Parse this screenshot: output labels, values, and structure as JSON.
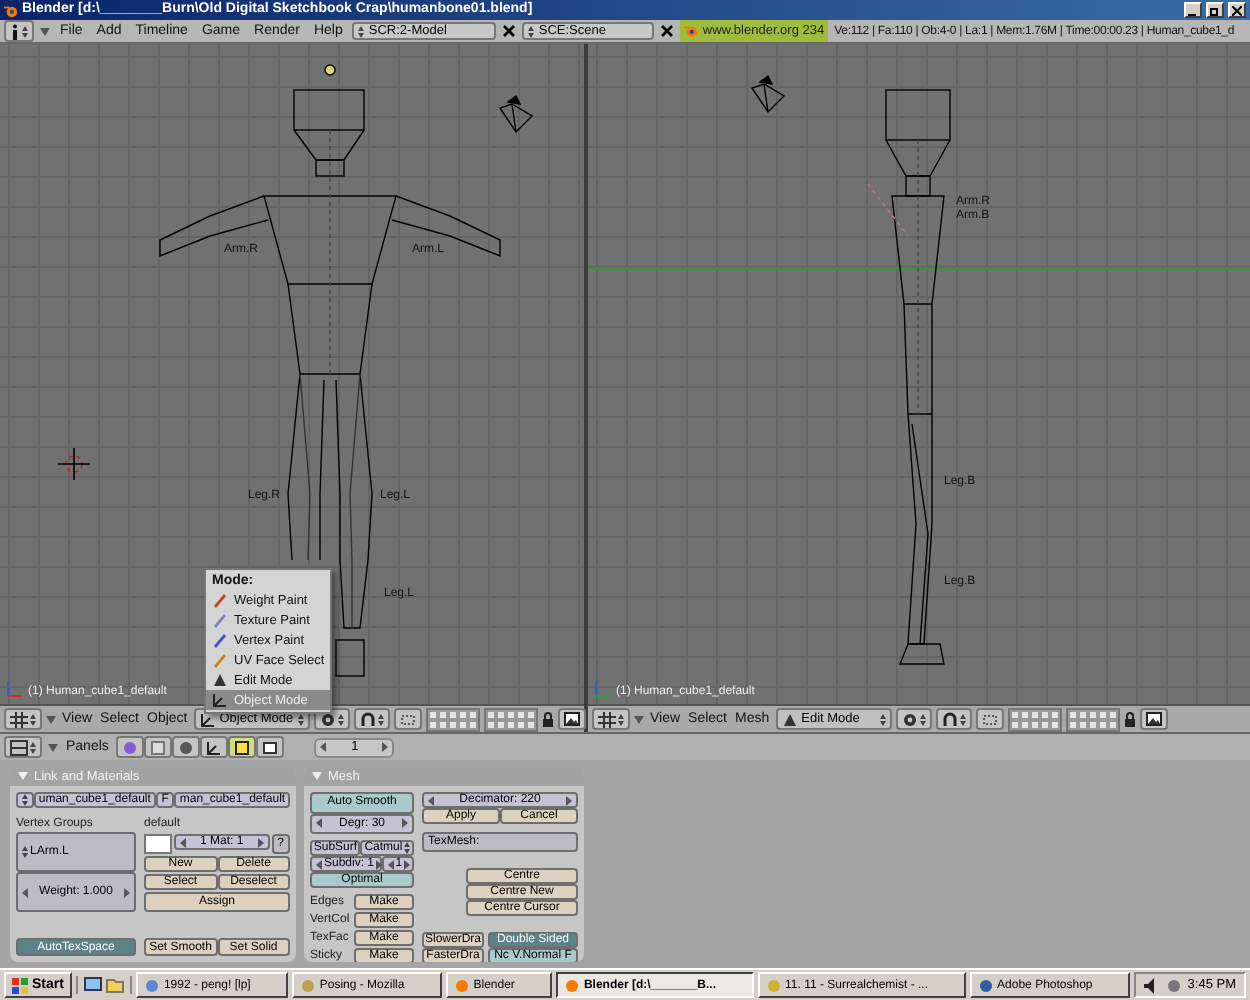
{
  "window": {
    "title": "Blender [d:\\________Burn\\Old Digital Sketchbook Crap\\humanbone01.blend]"
  },
  "menubar": {
    "menus": [
      "File",
      "Add",
      "Timeline",
      "Game",
      "Render",
      "Help"
    ],
    "screen": "SCR:2-Model",
    "scene": "SCE:Scene",
    "site": "www.blender.org 234",
    "stats": "Ve:112 | Fa:110 | Ob:4-0 | La:1 | Mem:1.76M | Time:00:00.23 | Human_cube1_d"
  },
  "viewports": [
    {
      "object_label": "(1) Human_cube1_default",
      "bone_labels": [
        "Arm.R",
        "Arm.L",
        "Leg.R",
        "Leg.L",
        "Leg.L"
      ],
      "header": {
        "menus": [
          "View",
          "Select",
          "Object"
        ],
        "mode": "Object Mode"
      }
    },
    {
      "object_label": "(1) Human_cube1_default",
      "bone_labels": [
        "Arm.R",
        "Arm.B",
        "Leg.B",
        "Leg.B"
      ],
      "header": {
        "menus": [
          "View",
          "Select",
          "Mesh"
        ],
        "mode": "Edit Mode"
      }
    }
  ],
  "mode_menu": {
    "title": "Mode:",
    "items": [
      {
        "label": "Weight Paint",
        "selected": false
      },
      {
        "label": "Texture Paint",
        "selected": false
      },
      {
        "label": "Vertex Paint",
        "selected": false
      },
      {
        "label": "UV Face Select",
        "selected": false
      },
      {
        "label": "Edit Mode",
        "selected": false
      },
      {
        "label": "Object Mode",
        "selected": true
      }
    ]
  },
  "buttons_header": {
    "panels_menu": "Panels",
    "context_tabs": [
      {
        "selected": false
      },
      {
        "selected": false
      },
      {
        "selected": false
      },
      {
        "selected": false
      },
      {
        "selected": true
      },
      {
        "selected": false
      }
    ],
    "frame": "1"
  },
  "link_panel": {
    "title": "Link and Materials",
    "mesh_name": "uman_cube1_default",
    "fake_user": "F",
    "object_name": "man_cube1_default",
    "vertex_groups_label": "Vertex Groups",
    "vertex_group": "LArm.L",
    "weight": "Weight: 1.000",
    "material_label": "default",
    "material_index": "1 Mat: 1",
    "material_help": "?",
    "group_buttons": [
      "New",
      "Delete",
      "Select",
      "Deselect"
    ],
    "assign": "Assign",
    "auto_tex_space": {
      "label": "AutoTexSpace",
      "on": true
    },
    "shading_buttons": [
      "Set Smooth",
      "Set Solid"
    ]
  },
  "mesh_panel": {
    "title": "Mesh",
    "auto_smooth": {
      "label": "Auto Smooth",
      "on": false
    },
    "degree": "Degr: 30",
    "subsurf": {
      "label": "SubSurf",
      "on": false
    },
    "subsurf_type": "Catmul",
    "subdiv": "Subdiv: 1",
    "subdiv_render": "1",
    "optimal": {
      "label": "Optimal",
      "on": false
    },
    "make_rows": [
      {
        "label": "Edges",
        "button": "Make"
      },
      {
        "label": "VertCol",
        "button": "Make"
      },
      {
        "label": "TexFac",
        "button": "Make"
      },
      {
        "label": "Sticky",
        "button": "Make"
      }
    ],
    "decimator": "Decimator: 220",
    "apply": "Apply",
    "cancel": "Cancel",
    "texmesh": "TexMesh:",
    "centre_buttons": [
      "Centre",
      "Centre New",
      "Centre Cursor"
    ],
    "draw_speed": [
      "SlowerDra",
      "FasterDra"
    ],
    "double_sided": {
      "label": "Double Sided",
      "on": true
    },
    "no_vnormal_flip": {
      "label": "Nc V.Normal F",
      "on": false
    }
  },
  "taskbar": {
    "start": "Start",
    "items": [
      {
        "label": "1992 - peng! [lp]",
        "selected": false
      },
      {
        "label": "Posing - Mozilla",
        "selected": false
      },
      {
        "label": "Blender",
        "selected": false
      },
      {
        "label": "Blender [d:\\_______B...",
        "selected": true
      },
      {
        "label": "11. 11 - Surrealchemist - ...",
        "selected": false
      },
      {
        "label": "Adobe Photoshop",
        "selected": false
      }
    ],
    "clock": "3:45 PM"
  }
}
